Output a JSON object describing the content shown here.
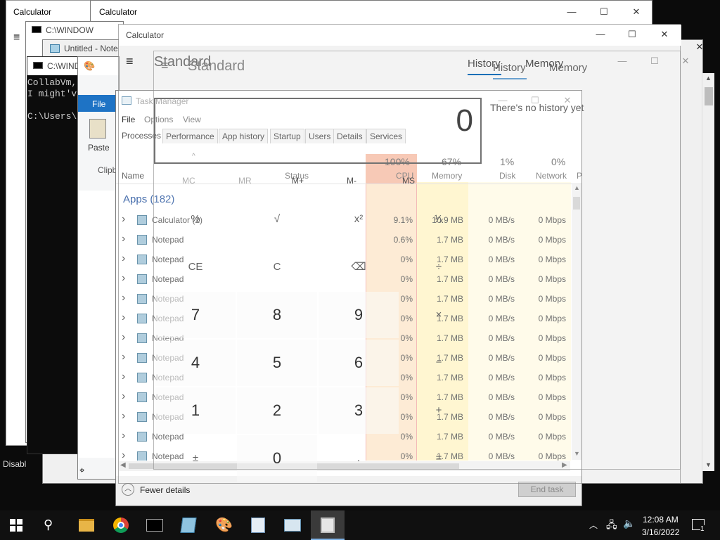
{
  "background_windows": {
    "calc_back1_title": "Calculator",
    "calc_back2_title": "Calculator",
    "cmd1_title": "C:\\WINDOW",
    "notepad_title": "Untitled - Note",
    "cmd2_title": "C:\\WIND",
    "console_lines": [
      "CollabVm,",
      "I might'v",
      "",
      "C:\\Users\\"
    ],
    "left_stub_text": "Disabl",
    "paint_file_tab": "File",
    "paint_paste": "Paste",
    "paint_clip": "Clipb"
  },
  "calculator": {
    "title": "Calculator",
    "mode": "Standard",
    "display": "0",
    "history_tab": "History",
    "memory_tab": "Memory",
    "no_history": "There's no history yet",
    "memory_keys": [
      "MC",
      "MR",
      "M+",
      "M-",
      "MS"
    ],
    "keys": [
      [
        "%",
        "√",
        "x²",
        "¹⁄ₓ"
      ],
      [
        "CE",
        "C",
        "⌫",
        "÷"
      ],
      [
        "7",
        "8",
        "9",
        "×"
      ],
      [
        "4",
        "5",
        "6",
        "−"
      ],
      [
        "1",
        "2",
        "3",
        "+"
      ],
      [
        "±",
        "0",
        ".",
        "="
      ]
    ],
    "second_title": "Standard",
    "second_history": "History",
    "second_memory": "Memory"
  },
  "task_manager": {
    "title": "Task Manager",
    "menu": [
      "File",
      "Options",
      "View"
    ],
    "tabs": [
      "Processes",
      "Performance",
      "App history",
      "Startup",
      "Users",
      "Details",
      "Services"
    ],
    "columns": {
      "name": "Name",
      "status": "Status",
      "cpu_pct": "100%",
      "cpu": "CPU",
      "mem_pct": "67%",
      "memory": "Memory",
      "disk_pct": "1%",
      "disk": "Disk",
      "net_pct": "0%",
      "network": "Network",
      "power": "P"
    },
    "group_label": "Apps (182)",
    "rows": [
      {
        "name": "Calculator (2)",
        "cpu": "9.1%",
        "mem": "10.9 MB",
        "disk": "0 MB/s",
        "net": "0 Mbps"
      },
      {
        "name": "Notepad",
        "cpu": "0.6%",
        "mem": "1.7 MB",
        "disk": "0 MB/s",
        "net": "0 Mbps"
      },
      {
        "name": "Notepad",
        "cpu": "0%",
        "mem": "1.7 MB",
        "disk": "0 MB/s",
        "net": "0 Mbps"
      },
      {
        "name": "Notepad",
        "cpu": "0%",
        "mem": "1.7 MB",
        "disk": "0 MB/s",
        "net": "0 Mbps"
      },
      {
        "name": "Notepad",
        "cpu": "0%",
        "mem": "1.7 MB",
        "disk": "0 MB/s",
        "net": "0 Mbps"
      },
      {
        "name": "Notepad",
        "cpu": "0%",
        "mem": "1.7 MB",
        "disk": "0 MB/s",
        "net": "0 Mbps"
      },
      {
        "name": "Notepad",
        "cpu": "0%",
        "mem": "1.7 MB",
        "disk": "0 MB/s",
        "net": "0 Mbps"
      },
      {
        "name": "Notepad",
        "cpu": "0%",
        "mem": "1.7 MB",
        "disk": "0 MB/s",
        "net": "0 Mbps"
      },
      {
        "name": "Notepad",
        "cpu": "0%",
        "mem": "1.7 MB",
        "disk": "0 MB/s",
        "net": "0 Mbps"
      },
      {
        "name": "Notepad",
        "cpu": "0%",
        "mem": "1.7 MB",
        "disk": "0 MB/s",
        "net": "0 Mbps"
      },
      {
        "name": "Notepad",
        "cpu": "0%",
        "mem": "1.7 MB",
        "disk": "0 MB/s",
        "net": "0 Mbps"
      },
      {
        "name": "Notepad",
        "cpu": "0%",
        "mem": "1.7 MB",
        "disk": "0 MB/s",
        "net": "0 Mbps"
      },
      {
        "name": "Notepad",
        "cpu": "0%",
        "mem": "1.7 MB",
        "disk": "0 MB/s",
        "net": "0 Mbps"
      }
    ],
    "fewer_details": "Fewer details",
    "end_task": "End task"
  },
  "taskbar": {
    "time": "12:08 AM",
    "date": "3/16/2022",
    "notification_count": "1",
    "apps": [
      "file-explorer",
      "chrome",
      "command-prompt",
      "notepad",
      "paint",
      "wordpad",
      "task-manager",
      "calculator"
    ]
  },
  "colors": {
    "accent": "#0063b1",
    "cpu_highlight": "#f9c9a8",
    "heat_light": "#fff4c4",
    "taskbar": "#101010"
  }
}
